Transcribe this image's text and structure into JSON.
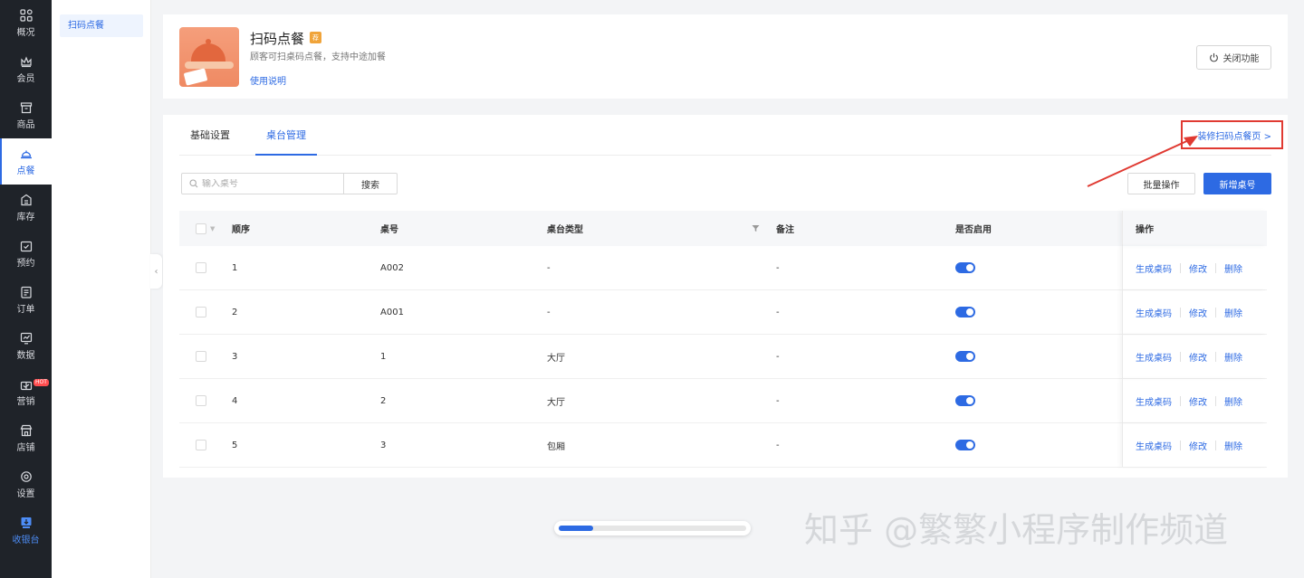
{
  "nav": {
    "items": [
      {
        "label": "概况",
        "icon": "grid-icon"
      },
      {
        "label": "会员",
        "icon": "crown-icon"
      },
      {
        "label": "商品",
        "icon": "store-icon"
      },
      {
        "label": "点餐",
        "icon": "bell-dish-icon",
        "active": true
      },
      {
        "label": "库存",
        "icon": "warehouse-icon"
      },
      {
        "label": "预约",
        "icon": "calendar-check-icon"
      },
      {
        "label": "订单",
        "icon": "clipboard-icon"
      },
      {
        "label": "数据",
        "icon": "chart-icon"
      },
      {
        "label": "营销",
        "icon": "gift-icon",
        "badge": "HOT"
      },
      {
        "label": "店铺",
        "icon": "shop-icon"
      },
      {
        "label": "设置",
        "icon": "gear-icon"
      },
      {
        "label": "收银台",
        "icon": "cashier-icon"
      }
    ]
  },
  "subnav": {
    "item": "扫码点餐"
  },
  "app": {
    "title": "扫码点餐",
    "badge": "荐",
    "description": "顾客可扫桌码点餐，支持中途加餐",
    "help_link": "使用说明",
    "close_button": "关闭功能"
  },
  "tabs": [
    {
      "label": "基础设置"
    },
    {
      "label": "桌台管理",
      "active": true
    }
  ],
  "decorate_link": "装修扫码点餐页 >",
  "search": {
    "placeholder": "输入桌号",
    "button": "搜索"
  },
  "actions": {
    "batch": "批量操作",
    "add": "新增桌号"
  },
  "table": {
    "headers": {
      "order": "顺序",
      "table_no": "桌号",
      "type": "桌台类型",
      "remark": "备注",
      "enabled": "是否启用",
      "ops": "操作"
    },
    "rows": [
      {
        "order": "1",
        "table_no": "A002",
        "type": "-",
        "remark": "-",
        "enabled": true
      },
      {
        "order": "2",
        "table_no": "A001",
        "type": "-",
        "remark": "-",
        "enabled": true
      },
      {
        "order": "3",
        "table_no": "1",
        "type": "大厅",
        "remark": "-",
        "enabled": true
      },
      {
        "order": "4",
        "table_no": "2",
        "type": "大厅",
        "remark": "-",
        "enabled": true
      },
      {
        "order": "5",
        "table_no": "3",
        "type": "包厢",
        "remark": "-",
        "enabled": true
      }
    ],
    "ops": {
      "generate": "生成桌码",
      "edit": "修改",
      "delete": "删除"
    }
  },
  "scrollbar": {
    "position": 0.18
  },
  "watermark": "知乎 @繁繁小程序制作频道",
  "colors": {
    "accent": "#2d6ae3",
    "nav_bg": "#1f2329",
    "highlight": "#e03a32"
  }
}
